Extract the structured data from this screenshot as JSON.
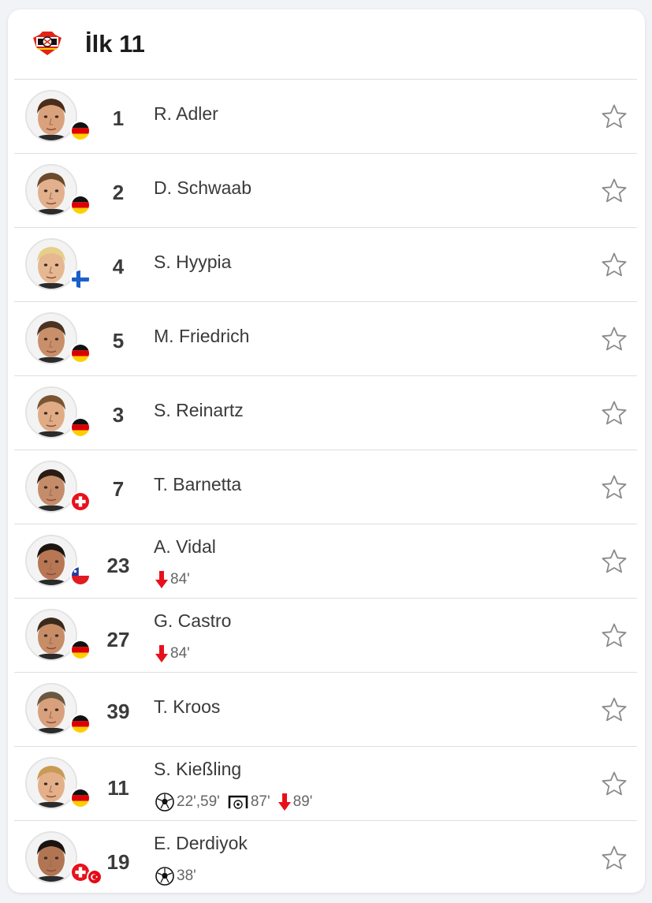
{
  "header": {
    "title": "İlk 11",
    "logo_icon": "bayer-leverkusen-crest-icon"
  },
  "colors": {
    "sub_off_arrow": "#e8111b",
    "star_outline": "#8a8a8a",
    "text_primary": "#3a3a3a"
  },
  "players": [
    {
      "number": "1",
      "name": "R. Adler",
      "flags": [
        "germany"
      ],
      "events": []
    },
    {
      "number": "2",
      "name": "D. Schwaab",
      "flags": [
        "germany"
      ],
      "events": []
    },
    {
      "number": "4",
      "name": "S. Hyypia",
      "flags": [
        "finland"
      ],
      "events": []
    },
    {
      "number": "5",
      "name": "M. Friedrich",
      "flags": [
        "germany"
      ],
      "events": []
    },
    {
      "number": "3",
      "name": "S. Reinartz",
      "flags": [
        "germany"
      ],
      "events": []
    },
    {
      "number": "7",
      "name": "T. Barnetta",
      "flags": [
        "switzerland"
      ],
      "events": []
    },
    {
      "number": "23",
      "name": "A. Vidal",
      "flags": [
        "chile"
      ],
      "events": [
        {
          "icon": "sub-off-arrow-icon",
          "text": "84'"
        }
      ]
    },
    {
      "number": "27",
      "name": "G. Castro",
      "flags": [
        "germany"
      ],
      "events": [
        {
          "icon": "sub-off-arrow-icon",
          "text": "84'"
        }
      ]
    },
    {
      "number": "39",
      "name": "T. Kroos",
      "flags": [
        "germany"
      ],
      "events": []
    },
    {
      "number": "11",
      "name": "S. Kießling",
      "flags": [
        "germany"
      ],
      "events": [
        {
          "icon": "goal-ball-icon",
          "text": "22',59'"
        },
        {
          "icon": "missed-penalty-goal-icon",
          "text": "87'"
        },
        {
          "icon": "sub-off-arrow-icon",
          "text": "89'"
        }
      ]
    },
    {
      "number": "19",
      "name": "E. Derdiyok",
      "flags": [
        "switzerland",
        "turkey"
      ],
      "events": [
        {
          "icon": "goal-ball-icon",
          "text": "38'"
        }
      ]
    }
  ]
}
